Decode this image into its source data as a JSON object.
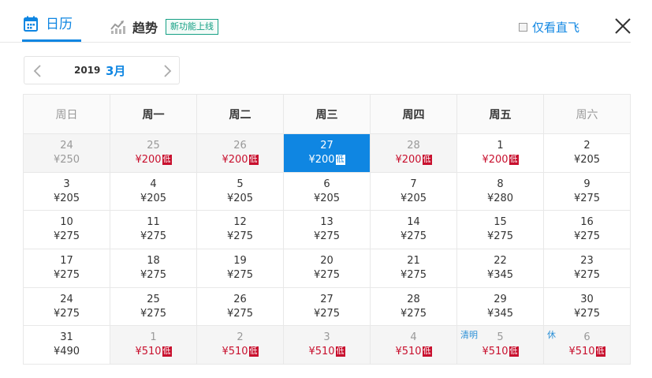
{
  "header": {
    "tab_calendar": "日历",
    "tab_trend": "趋势",
    "new_badge": "新功能上线",
    "direct_only": "仅看直飞"
  },
  "month_nav": {
    "year": "2019",
    "month": "3月"
  },
  "weekdays": [
    "周日",
    "周一",
    "周二",
    "周三",
    "周四",
    "周五",
    "周六"
  ],
  "low_tag": "低",
  "weeks": [
    [
      {
        "day": "24",
        "price": "¥250",
        "state": "past"
      },
      {
        "day": "25",
        "price": "¥200",
        "state": "past",
        "low": true
      },
      {
        "day": "26",
        "price": "¥200",
        "state": "past",
        "low": true
      },
      {
        "day": "27",
        "price": "¥200",
        "state": "selected",
        "low": true
      },
      {
        "day": "28",
        "price": "¥200",
        "state": "past",
        "low": true
      },
      {
        "day": "1",
        "price": "¥200",
        "state": "normal",
        "low": true
      },
      {
        "day": "2",
        "price": "¥205",
        "state": "normal"
      }
    ],
    [
      {
        "day": "3",
        "price": "¥205",
        "state": "normal"
      },
      {
        "day": "4",
        "price": "¥205",
        "state": "normal"
      },
      {
        "day": "5",
        "price": "¥205",
        "state": "normal"
      },
      {
        "day": "6",
        "price": "¥205",
        "state": "normal"
      },
      {
        "day": "7",
        "price": "¥205",
        "state": "normal"
      },
      {
        "day": "8",
        "price": "¥280",
        "state": "normal"
      },
      {
        "day": "9",
        "price": "¥275",
        "state": "normal"
      }
    ],
    [
      {
        "day": "10",
        "price": "¥275",
        "state": "normal"
      },
      {
        "day": "11",
        "price": "¥275",
        "state": "normal"
      },
      {
        "day": "12",
        "price": "¥275",
        "state": "normal"
      },
      {
        "day": "13",
        "price": "¥275",
        "state": "normal"
      },
      {
        "day": "14",
        "price": "¥275",
        "state": "normal"
      },
      {
        "day": "15",
        "price": "¥275",
        "state": "normal"
      },
      {
        "day": "16",
        "price": "¥275",
        "state": "normal"
      }
    ],
    [
      {
        "day": "17",
        "price": "¥275",
        "state": "normal"
      },
      {
        "day": "18",
        "price": "¥275",
        "state": "normal"
      },
      {
        "day": "19",
        "price": "¥275",
        "state": "normal"
      },
      {
        "day": "20",
        "price": "¥275",
        "state": "normal"
      },
      {
        "day": "21",
        "price": "¥275",
        "state": "normal"
      },
      {
        "day": "22",
        "price": "¥345",
        "state": "normal"
      },
      {
        "day": "23",
        "price": "¥275",
        "state": "normal"
      }
    ],
    [
      {
        "day": "24",
        "price": "¥275",
        "state": "normal"
      },
      {
        "day": "25",
        "price": "¥275",
        "state": "normal"
      },
      {
        "day": "26",
        "price": "¥275",
        "state": "normal"
      },
      {
        "day": "27",
        "price": "¥275",
        "state": "normal"
      },
      {
        "day": "28",
        "price": "¥275",
        "state": "normal"
      },
      {
        "day": "29",
        "price": "¥345",
        "state": "normal"
      },
      {
        "day": "30",
        "price": "¥275",
        "state": "normal"
      }
    ],
    [
      {
        "day": "31",
        "price": "¥490",
        "state": "normal"
      },
      {
        "day": "1",
        "price": "¥510",
        "state": "other",
        "low": true
      },
      {
        "day": "2",
        "price": "¥510",
        "state": "other",
        "low": true
      },
      {
        "day": "3",
        "price": "¥510",
        "state": "other",
        "low": true
      },
      {
        "day": "4",
        "price": "¥510",
        "state": "other",
        "low": true
      },
      {
        "day": "5",
        "price": "¥510",
        "state": "other",
        "low": true,
        "holiday": "清明"
      },
      {
        "day": "6",
        "price": "¥510",
        "state": "other",
        "low": true,
        "holiday": "休"
      }
    ]
  ],
  "colors": {
    "accent": "#0f86e2",
    "low_price": "#c8102e",
    "badge": "#16a085"
  }
}
